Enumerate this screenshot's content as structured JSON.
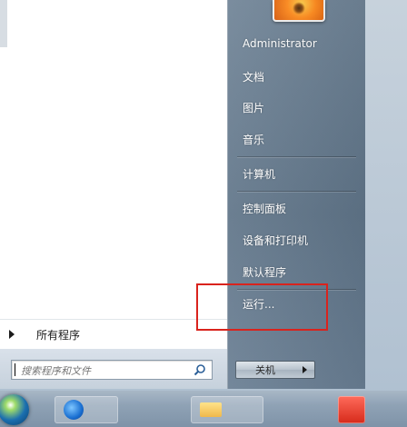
{
  "user": {
    "name": "Administrator"
  },
  "menu_right": [
    "文档",
    "图片",
    "音乐",
    "计算机",
    "控制面板",
    "设备和打印机",
    "默认程序",
    "运行..."
  ],
  "all_programs_label": "所有程序",
  "search": {
    "placeholder": "搜索程序和文件"
  },
  "shutdown_label": "关机",
  "icons": {
    "all_programs_arrow": "chevron-right-icon",
    "search": "search-icon",
    "shutdown_options": "chevron-right-icon",
    "start": "windows-orb-icon"
  },
  "colors": {
    "highlight_box": "#d9231d"
  }
}
